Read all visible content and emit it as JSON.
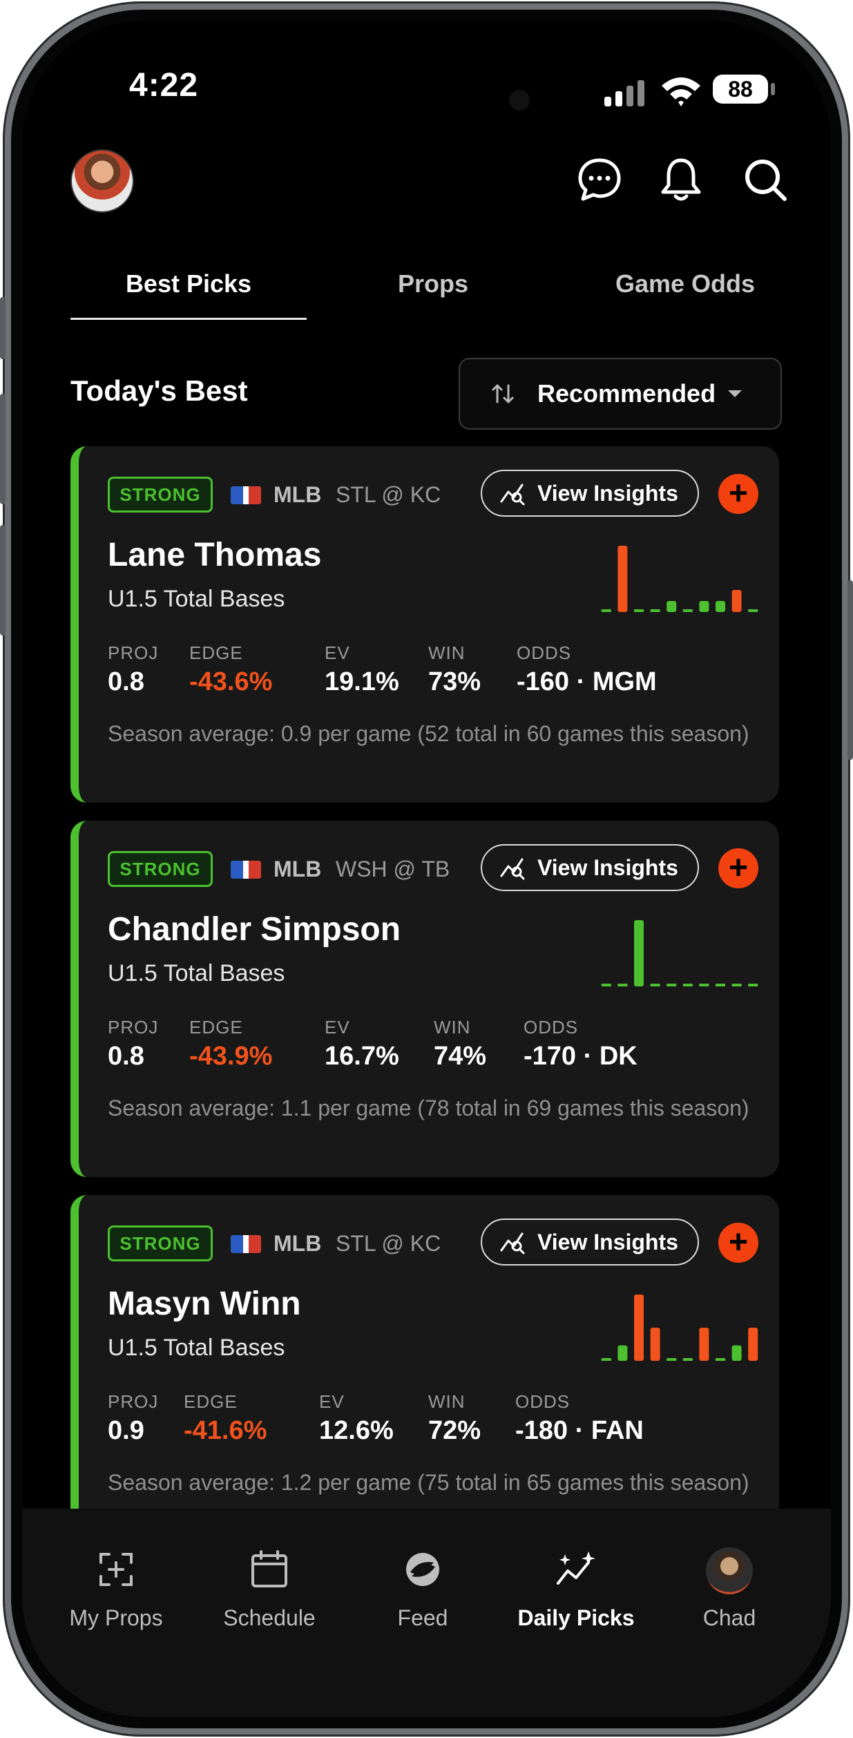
{
  "status_bar": {
    "time": "4:22",
    "battery": "88"
  },
  "tabs": [
    {
      "label": "Best Picks",
      "active": true
    },
    {
      "label": "Props",
      "active": false
    },
    {
      "label": "Game Odds",
      "active": false
    }
  ],
  "section": {
    "title": "Today's Best",
    "sort_label": "Recommended"
  },
  "cards": [
    {
      "badge": "STRONG",
      "league": "MLB",
      "matchup": "STL @ KC",
      "insights_label": "View Insights",
      "player": "Lane Thomas",
      "prop": "U1.5 Total Bases",
      "stats": {
        "proj_label": "PROJ",
        "proj": "0.8",
        "edge_label": "EDGE",
        "edge": "-43.6%",
        "ev_label": "EV",
        "ev": "19.1%",
        "win_label": "WIN",
        "win": "73%",
        "odds_label": "ODDS",
        "odds": "-160 · MGM"
      },
      "season": "Season average: 0.9 per game (52 total in 60 games this season)",
      "spark": [
        {
          "v": 0,
          "c": "g"
        },
        {
          "v": 3,
          "c": "o"
        },
        {
          "v": 0,
          "c": "g"
        },
        {
          "v": 0,
          "c": "g"
        },
        {
          "v": 0.5,
          "c": "g"
        },
        {
          "v": 0,
          "c": "g"
        },
        {
          "v": 0.5,
          "c": "g"
        },
        {
          "v": 0.5,
          "c": "g"
        },
        {
          "v": 1,
          "c": "o"
        },
        {
          "v": 0,
          "c": "g"
        }
      ]
    },
    {
      "badge": "STRONG",
      "league": "MLB",
      "matchup": "WSH @ TB",
      "insights_label": "View Insights",
      "player": "Chandler Simpson",
      "prop": "U1.5 Total Bases",
      "stats": {
        "proj_label": "PROJ",
        "proj": "0.8",
        "edge_label": "EDGE",
        "edge": "-43.9%",
        "ev_label": "EV",
        "ev": "16.7%",
        "win_label": "WIN",
        "win": "74%",
        "odds_label": "ODDS",
        "odds": "-170 · DK"
      },
      "season": "Season average: 1.1 per game (78 total in 69 games this season)",
      "spark": [
        {
          "v": 0,
          "c": "g"
        },
        {
          "v": 0,
          "c": "g"
        },
        {
          "v": 3,
          "c": "g"
        },
        {
          "v": 0,
          "c": "g"
        },
        {
          "v": 0,
          "c": "g"
        },
        {
          "v": 0,
          "c": "g"
        },
        {
          "v": 0,
          "c": "g"
        },
        {
          "v": 0,
          "c": "g"
        },
        {
          "v": 0,
          "c": "g"
        },
        {
          "v": 0,
          "c": "g"
        }
      ]
    },
    {
      "badge": "STRONG",
      "league": "MLB",
      "matchup": "STL @ KC",
      "insights_label": "View Insights",
      "player": "Masyn Winn",
      "prop": "U1.5 Total Bases",
      "stats": {
        "proj_label": "PROJ",
        "proj": "0.9",
        "edge_label": "EDGE",
        "edge": "-41.6%",
        "ev_label": "EV",
        "ev": "12.6%",
        "win_label": "WIN",
        "win": "72%",
        "odds_label": "ODDS",
        "odds": "-180 · FAN"
      },
      "season": "Season average: 1.2 per game (75 total in 65 games this season)",
      "spark": [
        {
          "v": 0,
          "c": "g"
        },
        {
          "v": 0.7,
          "c": "g"
        },
        {
          "v": 3,
          "c": "o"
        },
        {
          "v": 1.5,
          "c": "o"
        },
        {
          "v": 0,
          "c": "g"
        },
        {
          "v": 0,
          "c": "g"
        },
        {
          "v": 1.5,
          "c": "o"
        },
        {
          "v": 0,
          "c": "g"
        },
        {
          "v": 0.7,
          "c": "g"
        },
        {
          "v": 1.5,
          "c": "o"
        }
      ]
    }
  ],
  "colors": {
    "green": "#4cc02f",
    "orange": "#f2521c",
    "accent": "#f2410f"
  },
  "nav": [
    {
      "label": "My Props",
      "icon": "add-square-icon",
      "active": false
    },
    {
      "label": "Schedule",
      "icon": "calendar-icon",
      "active": false
    },
    {
      "label": "Feed",
      "icon": "feed-logo-icon",
      "active": false
    },
    {
      "label": "Daily Picks",
      "icon": "sparkle-trend-icon",
      "active": true
    },
    {
      "label": "Chad",
      "icon": "profile-avatar",
      "active": false
    }
  ]
}
